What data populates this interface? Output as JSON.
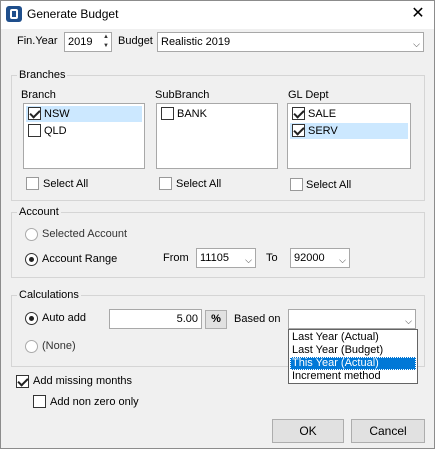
{
  "window": {
    "title": "Generate Budget",
    "close_glyph": "✕"
  },
  "top": {
    "fin_year_label": "Fin.Year",
    "fin_year_value": "2019",
    "budget_label": "Budget",
    "budget_value": "Realistic 2019"
  },
  "branches": {
    "group_title": "Branches",
    "branch": {
      "header": "Branch",
      "items": [
        {
          "label": "NSW",
          "checked": true,
          "selected": true
        },
        {
          "label": "QLD",
          "checked": false,
          "selected": false
        }
      ],
      "select_all": "Select All"
    },
    "subbranch": {
      "header": "SubBranch",
      "items": [
        {
          "label": "BANK",
          "checked": false,
          "selected": false
        }
      ],
      "select_all": "Select All"
    },
    "gldept": {
      "header": "GL Dept",
      "items": [
        {
          "label": "SALE",
          "checked": true,
          "selected": false
        },
        {
          "label": "SERV",
          "checked": true,
          "selected": true
        }
      ],
      "select_all": "Select All"
    }
  },
  "account": {
    "group_title": "Account",
    "selected_account_label": "Selected Account",
    "account_range_label": "Account Range",
    "mode": "Account Range",
    "from_label": "From",
    "from_value": "11105",
    "to_label": "To",
    "to_value": "92000"
  },
  "calculations": {
    "group_title": "Calculations",
    "auto_add_label": "Auto add",
    "auto_add_value": "5.00",
    "percent_button": "%",
    "based_on_label": "Based on",
    "based_on_value": "",
    "none_label": "(None)",
    "mode": "Auto add",
    "based_on_options": [
      "Last Year (Actual)",
      "Last Year (Budget)",
      "This Year (Actual)",
      "Increment method"
    ],
    "highlighted_option": "This Year (Actual)"
  },
  "options": {
    "add_missing_months_label": "Add missing months",
    "add_missing_months_checked": true,
    "add_non_zero_only_label": "Add non zero only",
    "add_non_zero_only_checked": false
  },
  "buttons": {
    "ok": "OK",
    "cancel": "Cancel"
  },
  "icons": {
    "spin_up": "▲",
    "spin_down": "▼",
    "combo": "⌵"
  }
}
